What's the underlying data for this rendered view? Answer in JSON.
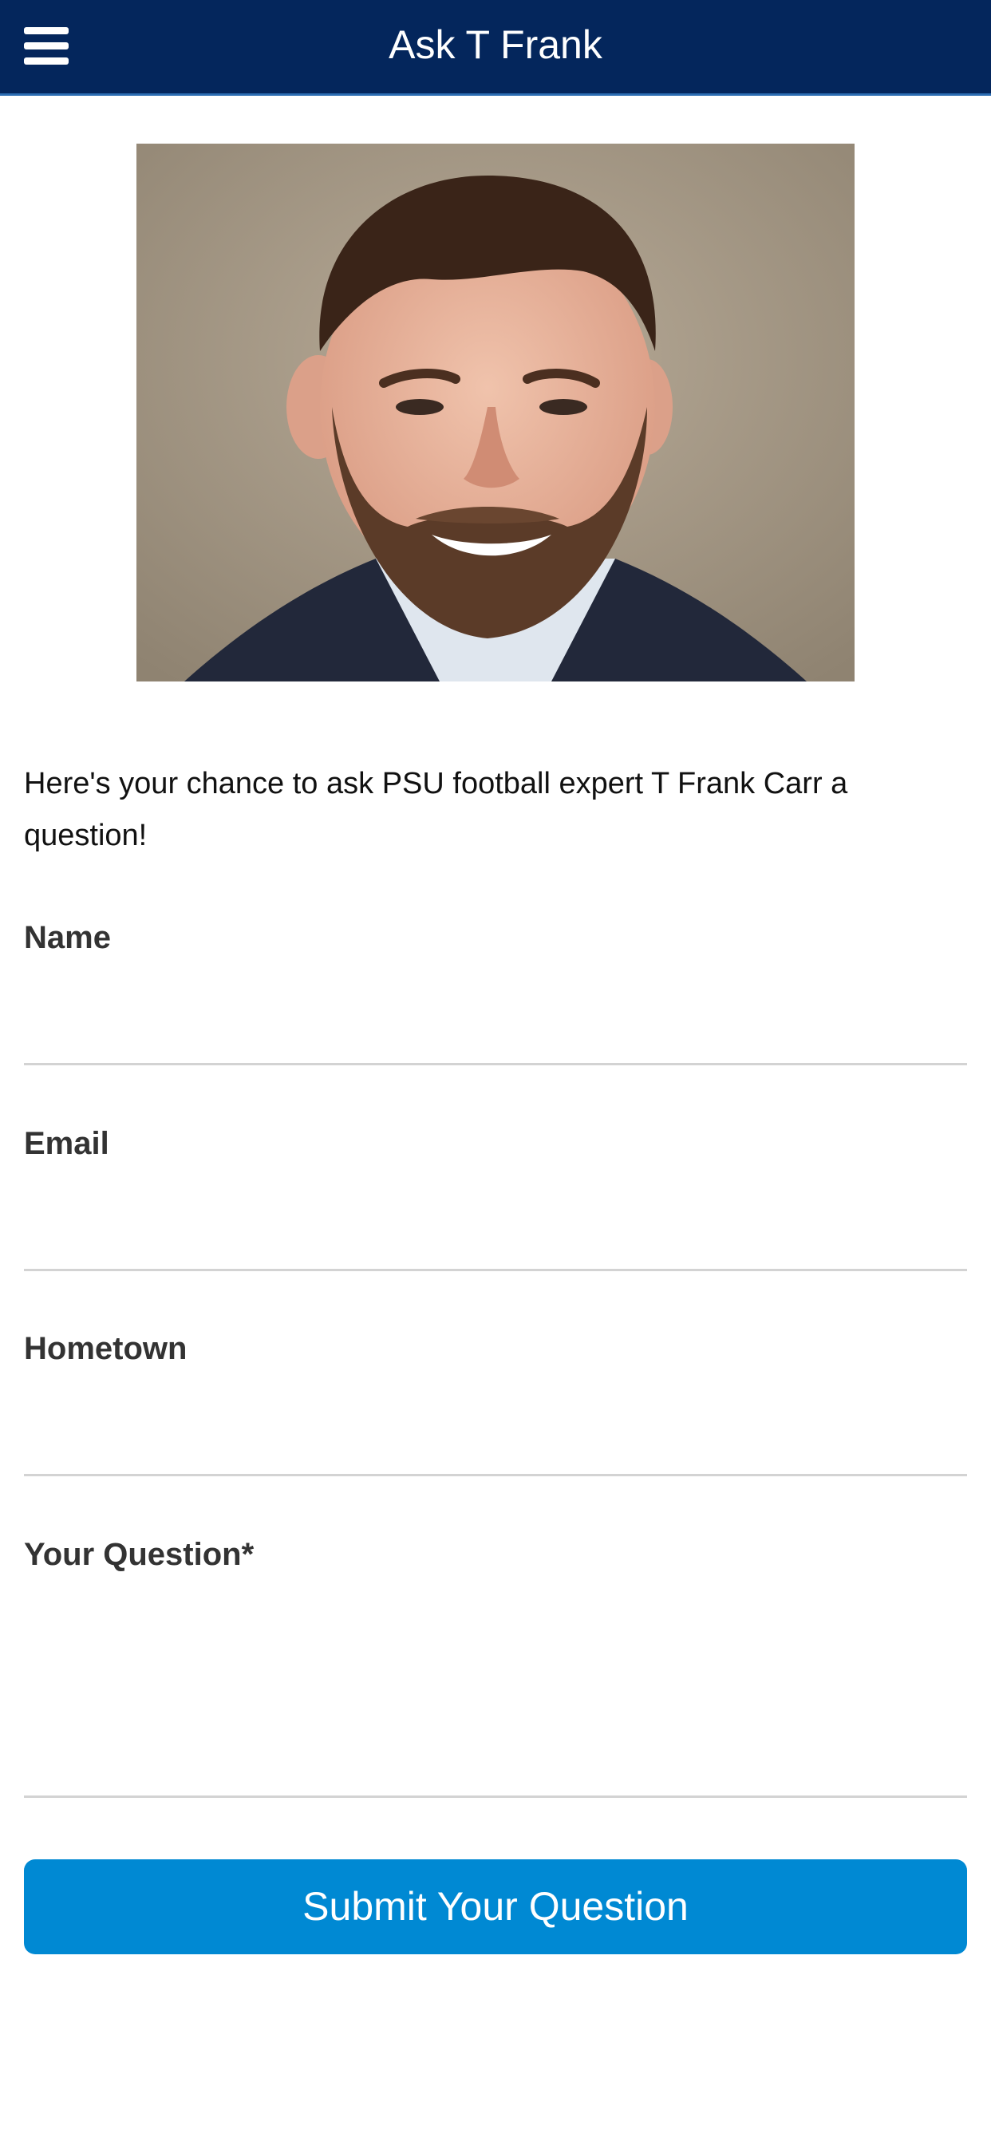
{
  "header": {
    "title": "Ask T Frank",
    "menu_icon": "hamburger-menu-icon"
  },
  "colors": {
    "header_bg": "#04265c",
    "header_accent": "#2c6db3",
    "button_bg": "#0089d3",
    "label_text": "#333333",
    "divider": "#d3d3d3"
  },
  "intro_text": "Here's your chance to ask PSU football expert T Frank Carr a question!",
  "form": {
    "name": {
      "label": "Name",
      "value": ""
    },
    "email": {
      "label": "Email",
      "value": ""
    },
    "hometown": {
      "label": "Hometown",
      "value": ""
    },
    "question": {
      "label": "Your Question*",
      "value": ""
    },
    "submit_label": "Submit Your Question"
  }
}
